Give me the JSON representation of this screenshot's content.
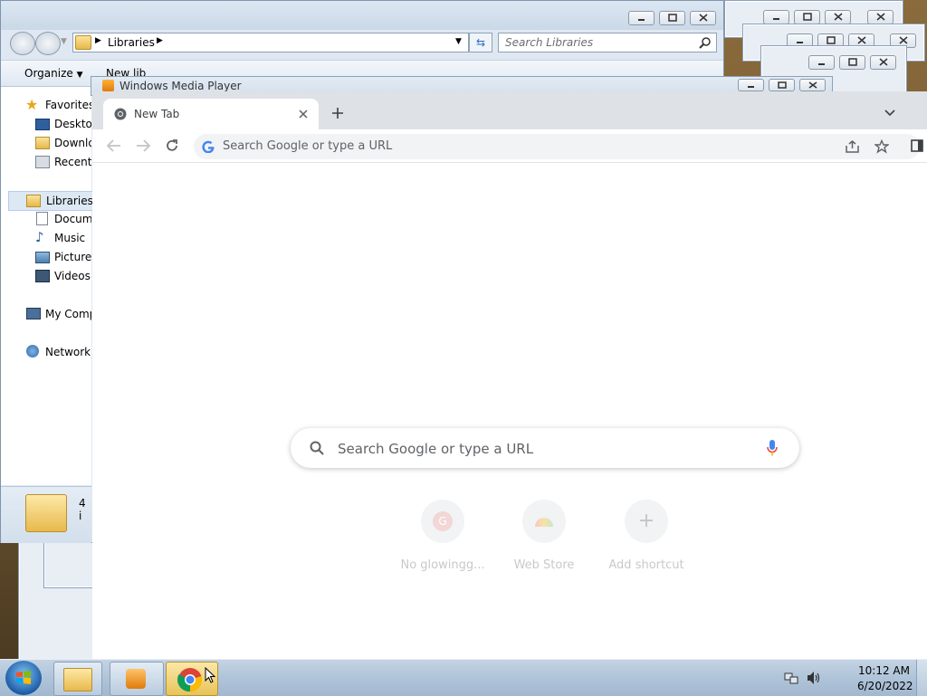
{
  "explorer": {
    "breadcrumb": "Libraries",
    "search_placeholder": "Search Libraries",
    "organize_label": "Organize",
    "new_library_label": "New lib",
    "nav": {
      "favorites": "Favorites",
      "desktop": "Desktop",
      "downloads": "Downlo",
      "recent": "Recent P",
      "libraries": "Libraries",
      "documents": "Docume",
      "music": "Music",
      "pictures": "Pictures",
      "videos": "Videos",
      "computer": "My Comp",
      "network": "Network"
    },
    "details_count": "4 i"
  },
  "wmp": {
    "title": "Windows Media Player"
  },
  "chrome": {
    "tab_title": "New Tab",
    "omnibox_placeholder": "Search Google or type a URL",
    "ntp_search_placeholder": "Search Google or type a URL",
    "shortcuts": [
      {
        "label": "No glowingg...",
        "letter": "G"
      },
      {
        "label": "Web Store",
        "letter": ""
      },
      {
        "label": "Add shortcut",
        "letter": "+"
      }
    ]
  },
  "taskbar": {
    "time": "10:12 AM",
    "date": "6/20/2022"
  },
  "colors": {
    "chrome_frame": "#dee1e6",
    "omnibox_bg": "#f1f3f4",
    "taskbar": "#b0c4d9",
    "google_blue": "#4285f4"
  }
}
